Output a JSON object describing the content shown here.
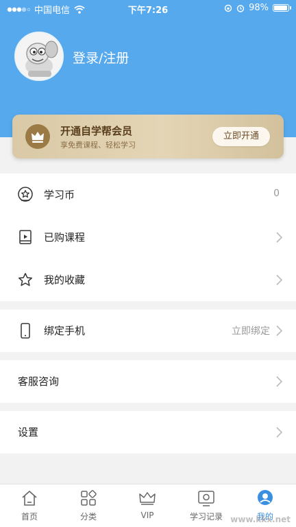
{
  "status_bar": {
    "carrier": "中国电信",
    "time": "下午7:26",
    "battery": "98%",
    "battery_level": 0.98
  },
  "header": {
    "login_label": "登录/注册"
  },
  "vip_card": {
    "title": "开通自学帮会员",
    "subtitle": "享免费课程、轻松学习",
    "button_label": "立即开通"
  },
  "menu": {
    "coins": {
      "label": "学习币",
      "value": "0"
    },
    "purchased": {
      "label": "已购课程"
    },
    "favorites": {
      "label": "我的收藏"
    },
    "phone": {
      "label": "绑定手机",
      "value": "立即绑定"
    },
    "service": {
      "label": "客服咨询"
    },
    "settings": {
      "label": "设置"
    }
  },
  "tabbar": {
    "tabs": [
      {
        "label": "首页",
        "icon": "home-icon"
      },
      {
        "label": "分类",
        "icon": "category-icon"
      },
      {
        "label": "VIP",
        "icon": "crown-icon"
      },
      {
        "label": "学习记录",
        "icon": "record-icon"
      },
      {
        "label": "我的",
        "icon": "profile-icon",
        "active": true
      }
    ]
  },
  "watermark": "www.kkx.net",
  "colors": {
    "header": "#57a9ee",
    "accent": "#3b8fe0",
    "vip_gold": "#d9c9a6"
  }
}
